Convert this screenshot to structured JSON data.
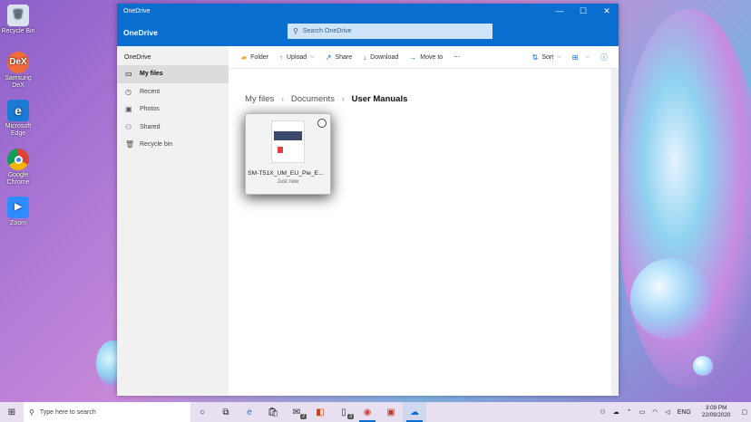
{
  "desktop": {
    "icons": [
      {
        "label": "Recycle Bin",
        "icon": "recycle-bin-icon"
      },
      {
        "label": "Samsung DeX",
        "icon": "dex-icon",
        "badge": "DeX"
      },
      {
        "label": "Microsoft Edge",
        "icon": "edge-icon"
      },
      {
        "label": "Google Chrome",
        "icon": "chrome-icon"
      },
      {
        "label": "Zoom",
        "icon": "zoom-icon"
      }
    ]
  },
  "window": {
    "title": "OneDrive",
    "controls": {
      "minimize": "—",
      "maximize": "☐",
      "close": "✕"
    },
    "brand": "OneDrive",
    "search_placeholder": "Search OneDrive",
    "header_icons": {
      "more": "⋯",
      "help": "?"
    }
  },
  "sidebar": {
    "title": "OneDrive",
    "items": [
      {
        "label": "My files",
        "icon": "folder-icon",
        "active": true
      },
      {
        "label": "Recent",
        "icon": "clock-icon"
      },
      {
        "label": "Photos",
        "icon": "image-icon"
      },
      {
        "label": "Shared",
        "icon": "people-icon"
      },
      {
        "label": "Recycle bin",
        "icon": "trash-icon"
      }
    ]
  },
  "toolbar": {
    "folder": "Folder",
    "upload": "Upload",
    "share": "Share",
    "download": "Download",
    "move_to": "Move to",
    "more": "⋯",
    "sort": "Sort"
  },
  "breadcrumb": {
    "items": [
      "My files",
      "Documents",
      "User Manuals"
    ]
  },
  "files": [
    {
      "name": "SM-T51X_UM_EU_Pie_E...",
      "modified": "Just now"
    }
  ],
  "taskbar": {
    "search_placeholder": "Type here to search",
    "badges": {
      "mail": "2",
      "phone": "3"
    },
    "language": "ENG",
    "time": "3:09 PM",
    "date": "22/09/2020"
  },
  "colors": {
    "accent": "#0a6ed1"
  }
}
